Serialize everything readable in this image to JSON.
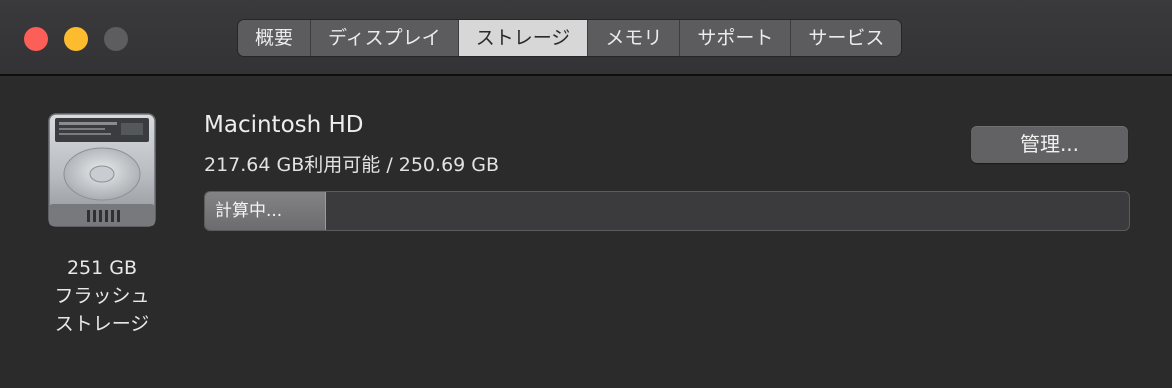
{
  "window": {
    "traffic_lights": [
      "close",
      "minimize",
      "zoom"
    ]
  },
  "tabs": [
    {
      "label": "概要",
      "active": false
    },
    {
      "label": "ディスプレイ",
      "active": false
    },
    {
      "label": "ストレージ",
      "active": true
    },
    {
      "label": "メモリ",
      "active": false
    },
    {
      "label": "サポート",
      "active": false
    },
    {
      "label": "サービス",
      "active": false
    }
  ],
  "disk": {
    "icon": "hard-drive-icon",
    "capacity_lines": [
      "251 GB",
      "フラッシュ",
      "ストレージ"
    ]
  },
  "volume": {
    "name": "Macintosh HD",
    "space": "217.64 GB利用可能 / 250.69 GB",
    "manage_label": "管理...",
    "bar_label": "計算中...",
    "bar_progress": 0.13
  },
  "colors": {
    "close": "#fc5f57",
    "minimize": "#fdbc2e",
    "zoom": "#5d5d5f",
    "active_tab": "#d7d7d7"
  }
}
